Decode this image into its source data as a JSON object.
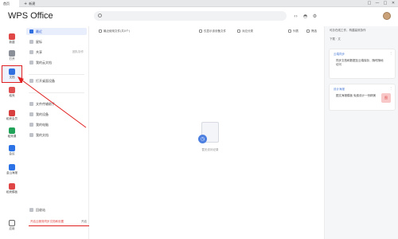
{
  "titlebar": {
    "tab_home": "首页",
    "tab_new": "新建",
    "tab_new_plus": "+",
    "controls": [
      "□",
      "—",
      "□",
      "✕"
    ]
  },
  "header": {
    "app_title": "WPS Office",
    "search_placeholder": "",
    "icons": [
      "code-icon",
      "cast-icon",
      "settings-icon"
    ]
  },
  "rail": [
    {
      "label": "新建",
      "color": "#e04848"
    },
    {
      "label": "打开",
      "color": "#8a8f98"
    },
    {
      "label": "文档",
      "color": "#2f6fe0"
    },
    {
      "label": "稻壳",
      "color": "#e05050"
    },
    {
      "label": "稻壳会员",
      "color": "#d84040"
    },
    {
      "label": "稻壳课",
      "color": "#22a35a"
    },
    {
      "label": "会议",
      "color": "#2a72e6"
    },
    {
      "label": "金山海报",
      "color": "#2a72e6"
    },
    {
      "label": "稻壳模板",
      "color": "#e04545"
    },
    {
      "label": "应用",
      "color": "#666"
    }
  ],
  "sidebar": {
    "items": [
      {
        "label": "最近"
      },
      {
        "label": "星标"
      },
      {
        "label": "共享",
        "badge": "团队协作"
      },
      {
        "label": "我的云文档"
      },
      {
        "label": "打开桌面设备"
      },
      {
        "label": "文件传输助手"
      },
      {
        "label": "我的设备"
      },
      {
        "label": "我的电脑"
      },
      {
        "label": "我的文档"
      }
    ],
    "footer_item": "回收站",
    "footer_link": "开启云服务同步文档和设置",
    "footer_btn": "开启"
  },
  "main": {
    "toolbar": [
      {
        "label": "最近使用文件(共0个)"
      },
      {
        "label": "仅显示该设备文件"
      },
      {
        "label": "对应分类"
      },
      {
        "label": "列表"
      },
      {
        "label": "筛选"
      }
    ],
    "empty_text": "暂无访问记录"
  },
  "rpanel": {
    "top": "可办在线工作，构建高效协作",
    "sub": "下载 · 文",
    "card1": {
      "title": "云端同步",
      "body": "同步文档和数据至云端保存，随时随地访问"
    },
    "card2": {
      "title": "设计海报",
      "body": "图文海报模板 免费设计一份精美",
      "thumb": "图"
    }
  },
  "colors": {
    "accent": "#2f6fe0",
    "annotation": "#e02020"
  }
}
